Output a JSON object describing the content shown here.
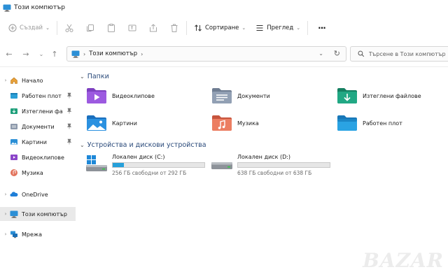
{
  "window": {
    "title": "Този компютър"
  },
  "toolbar": {
    "new_label": "Създай",
    "sort_label": "Сортиране",
    "view_label": "Преглед",
    "more_label": "···"
  },
  "address": {
    "path_label": "Този компютър",
    "search_placeholder": "Търсене в Този компютър"
  },
  "sidebar": {
    "items": [
      {
        "label": "Начало",
        "icon": "home-icon"
      },
      {
        "label": "Работен плот",
        "icon": "desktop-folder-icon",
        "pinned": true
      },
      {
        "label": "Изтеглени файлове",
        "icon": "downloads-folder-icon",
        "pinned": true
      },
      {
        "label": "Документи",
        "icon": "documents-folder-icon",
        "pinned": true
      },
      {
        "label": "Картини",
        "icon": "pictures-folder-icon",
        "pinned": true
      },
      {
        "label": "Видеоклипове",
        "icon": "videos-folder-icon"
      },
      {
        "label": "Музика",
        "icon": "music-folder-icon"
      },
      {
        "label": "OneDrive",
        "icon": "onedrive-icon"
      },
      {
        "label": "Този компютър",
        "icon": "this-pc-icon",
        "selected": true
      },
      {
        "label": "Мрежа",
        "icon": "network-icon"
      }
    ]
  },
  "content": {
    "folders_header": "Папки",
    "folders": [
      {
        "label": "Видеоклипове",
        "icon": "videos-folder-icon"
      },
      {
        "label": "Документи",
        "icon": "documents-folder-icon"
      },
      {
        "label": "Изтеглени файлове",
        "icon": "downloads-folder-icon"
      },
      {
        "label": "Картини",
        "icon": "pictures-folder-icon"
      },
      {
        "label": "Музика",
        "icon": "music-folder-icon"
      },
      {
        "label": "Работен плот",
        "icon": "desktop-folder-icon"
      }
    ],
    "drives_header": "Устройства и дискови устройства",
    "drives": [
      {
        "label": "Локален диск (C:)",
        "free_text": "256 ГБ свободни от 292 ГБ",
        "used_fraction": 0.123
      },
      {
        "label": "Локален диск (D:)",
        "free_text": "638 ГБ свободни от 638 ГБ",
        "used_fraction": 0.0
      }
    ]
  },
  "watermark": "BAZAR",
  "colors": {
    "accent": "#26a0da",
    "group_header": "#2a4a7a"
  }
}
